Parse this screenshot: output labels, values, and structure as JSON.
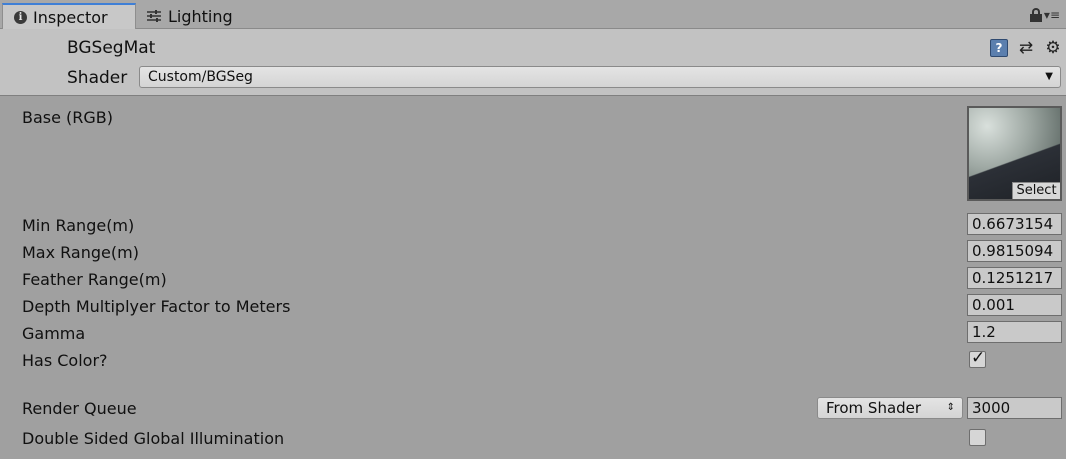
{
  "tabs": [
    {
      "label": "Inspector",
      "icon": "info-icon"
    },
    {
      "label": "Lighting",
      "icon": "sliders-icon"
    }
  ],
  "tabbar_right": {
    "lock": "lock-icon",
    "menu": "▾≡"
  },
  "header": {
    "material_name": "BGSegMat",
    "shader_label": "Shader",
    "shader_value": "Custom/BGSeg",
    "icons": [
      "help-icon",
      "preset-icon",
      "gear-icon"
    ]
  },
  "properties": {
    "base": {
      "label": "Base (RGB)",
      "select_label": "Select"
    },
    "min_range": {
      "label": "Min Range(m)",
      "value": "0.6673154"
    },
    "max_range": {
      "label": "Max Range(m)",
      "value": "0.9815094"
    },
    "feather_range": {
      "label": "Feather Range(m)",
      "value": "0.1251217"
    },
    "depth_multiplyer": {
      "label": "Depth Multiplyer Factor to Meters",
      "value": "0.001"
    },
    "gamma": {
      "label": "Gamma",
      "value": "1.2"
    },
    "has_color": {
      "label": "Has Color?",
      "checked": true
    },
    "render_queue": {
      "label": "Render Queue",
      "mode": "From Shader",
      "value": "3000"
    },
    "double_sided_gi": {
      "label": "Double Sided Global Illumination",
      "checked": false
    }
  },
  "colors": {
    "accent": "#3f7fd6",
    "panel": "#a0a0a0",
    "header": "#c2c2c2"
  }
}
